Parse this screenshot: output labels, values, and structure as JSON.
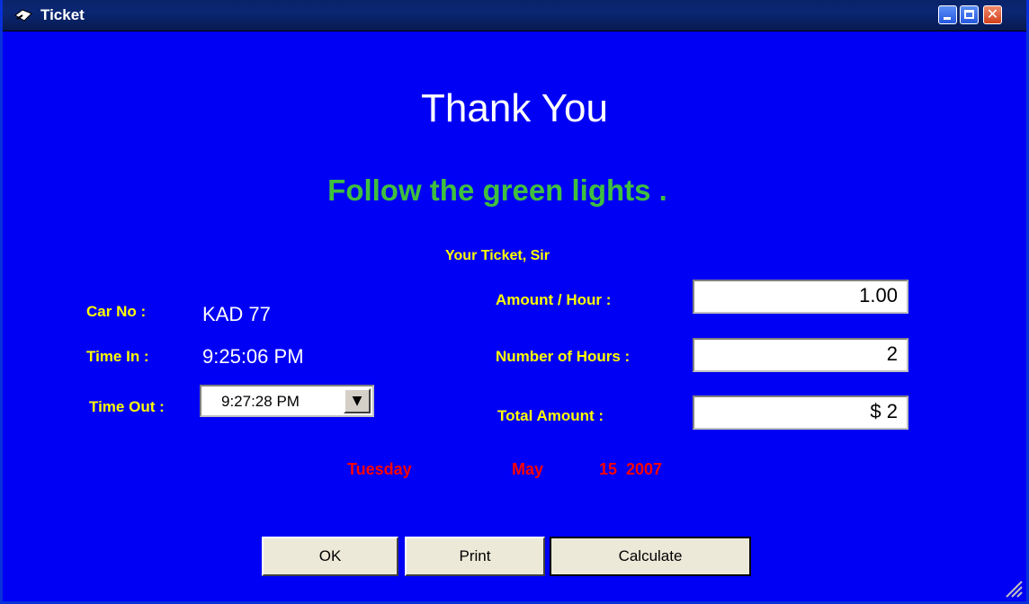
{
  "window": {
    "title": "Ticket",
    "app_icon": "app-icon"
  },
  "titlebar_buttons": {
    "minimize": "minimize-icon",
    "maximize": "maximize-icon",
    "close": "close-icon"
  },
  "heading": "Thank You",
  "subheading": "Follow the green lights .",
  "ticket_caption": "Your Ticket, Sir",
  "left": {
    "car_no_label": "Car No :",
    "car_no_value": "KAD 77",
    "time_in_label": "Time In :",
    "time_in_value": "9:25:06 PM",
    "time_out_label": "Time Out :",
    "time_out_value": "9:27:28 PM"
  },
  "right": {
    "amount_per_hour_label": "Amount / Hour :",
    "amount_per_hour_value": "1.00",
    "hours_label": "Number of Hours :",
    "hours_value": "2",
    "total_label": "Total Amount :",
    "total_value": "$ 2"
  },
  "date": {
    "weekday": "Tuesday",
    "month": "May",
    "day_year": "15  2007"
  },
  "buttons": {
    "ok": "OK",
    "print": "Print",
    "calculate": "Calculate"
  },
  "colors": {
    "background": "#0000f4",
    "label": "#ffff00",
    "accent_green": "#3fbf3f",
    "date_red": "#ff0000"
  }
}
